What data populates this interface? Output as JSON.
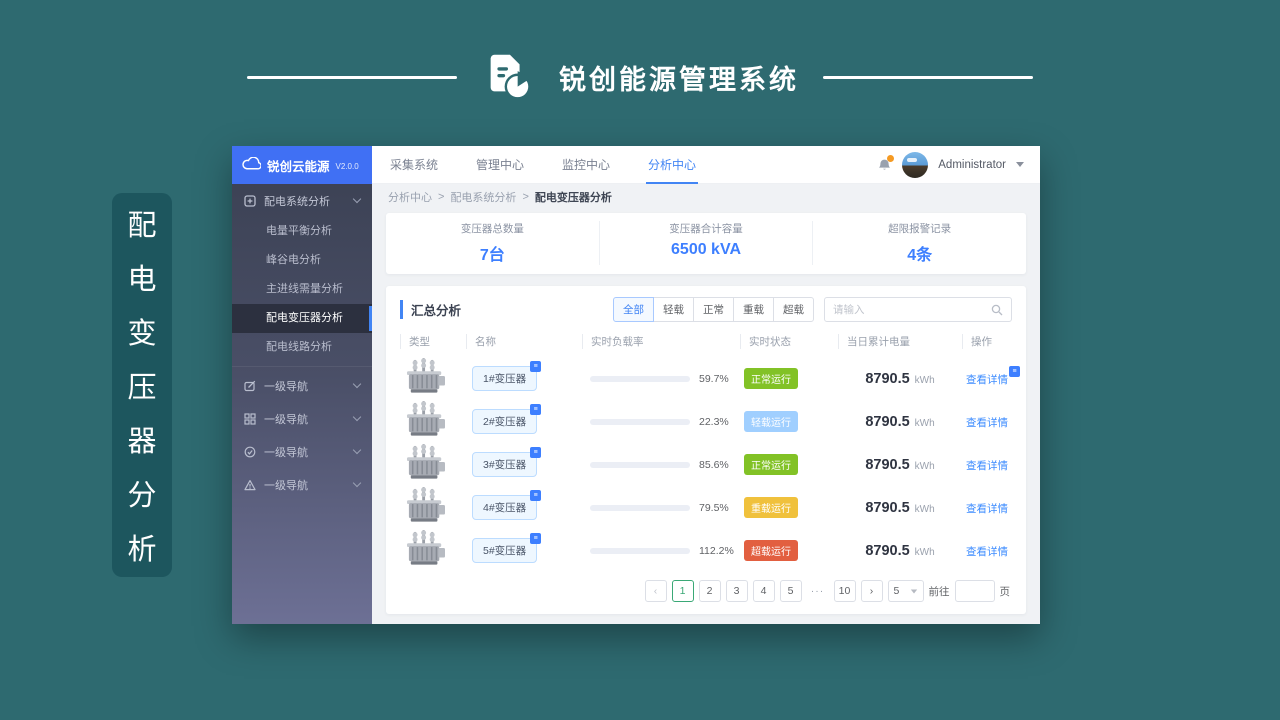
{
  "banner": {
    "title": "锐创能源管理系统"
  },
  "side_label": {
    "chars": [
      "配",
      "电",
      "变",
      "压",
      "器",
      "分",
      "析"
    ]
  },
  "sidebar": {
    "logo": {
      "name": "锐创云能源",
      "version": "V2.0.0"
    },
    "parent_item": {
      "label": "配电系统分析"
    },
    "sub_items": [
      {
        "label": "电量平衡分析"
      },
      {
        "label": "峰谷电分析"
      },
      {
        "label": "主进线需量分析"
      },
      {
        "label": "配电变压器分析"
      },
      {
        "label": "配电线路分析"
      }
    ],
    "extra_items": [
      {
        "label": "一级导航"
      },
      {
        "label": "一级导航"
      },
      {
        "label": "一级导航"
      },
      {
        "label": "一级导航"
      }
    ]
  },
  "topbar": {
    "nav": [
      {
        "label": "采集系统"
      },
      {
        "label": "管理中心"
      },
      {
        "label": "监控中心"
      },
      {
        "label": "分析中心"
      }
    ],
    "user": {
      "name": "Administrator"
    }
  },
  "breadcrumb": {
    "items": [
      "分析中心",
      "配电系统分析",
      "配电变压器分析"
    ],
    "separator": ">"
  },
  "stats": [
    {
      "label": "变压器总数量",
      "value": "7台"
    },
    {
      "label": "变压器合计容量",
      "value": "6500 kVA"
    },
    {
      "label": "超限报警记录",
      "value": "4条"
    }
  ],
  "summary": {
    "section_title": "汇总分析",
    "filter_buttons": [
      "全部",
      "轻载",
      "正常",
      "重载",
      "超载"
    ],
    "active_filter": "全部",
    "search_placeholder": "请输入"
  },
  "table": {
    "headers": [
      "类型",
      "名称",
      "实时负载率",
      "实时状态",
      "当日累计电量",
      "操作"
    ],
    "rows": [
      {
        "name": "1#变压器",
        "load_pct": "59.7%",
        "status": "正常运行",
        "status_type": "normal",
        "energy": "8790.5",
        "energy_unit": "kWh",
        "action": "查看详情"
      },
      {
        "name": "2#变压器",
        "load_pct": "22.3%",
        "status": "轻载运行",
        "status_type": "light",
        "energy": "8790.5",
        "energy_unit": "kWh",
        "action": "查看详情"
      },
      {
        "name": "3#变压器",
        "load_pct": "85.6%",
        "status": "正常运行",
        "status_type": "normal",
        "energy": "8790.5",
        "energy_unit": "kWh",
        "action": "查看详情"
      },
      {
        "name": "4#变压器",
        "load_pct": "79.5%",
        "status": "重载运行",
        "status_type": "heavy",
        "energy": "8790.5",
        "energy_unit": "kWh",
        "action": "查看详情"
      },
      {
        "name": "5#变压器",
        "load_pct": "112.2%",
        "status": "超载运行",
        "status_type": "over",
        "energy": "8790.5",
        "energy_unit": "kWh",
        "action": "查看详情"
      }
    ]
  },
  "status_colors": {
    "normal": "#82c226",
    "light": "#a0cfff",
    "heavy": "#f0c13c",
    "over": "#e25f40"
  },
  "accent_colors": {
    "primary_blue": "#3d7fff",
    "pagination_active": "#3aa876",
    "page_background": "#2e6a70"
  },
  "pagination": {
    "prev": "‹",
    "next": "›",
    "pages": [
      "1",
      "2",
      "3",
      "4",
      "5",
      "···",
      "10"
    ],
    "active_page": "1",
    "page_size": "5",
    "goto_label": "前往",
    "page_unit": "页"
  }
}
